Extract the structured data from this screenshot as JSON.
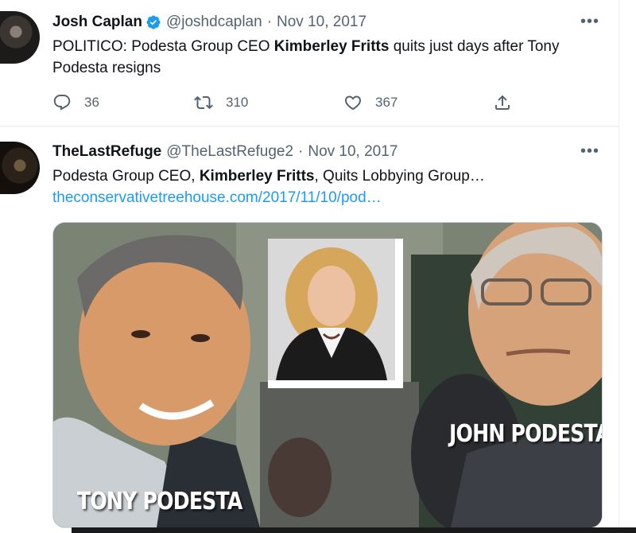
{
  "tweets": [
    {
      "author_name": "Josh Caplan",
      "author_handle": "@joshdcaplan",
      "separator": "·",
      "date": "Nov 10, 2017",
      "verified": true,
      "text_parts": {
        "before": "POLITICO: Podesta Group CEO ",
        "bold": "Kimberley Fritts",
        "after": " quits just days after Tony Podesta resigns"
      },
      "actions": {
        "reply_count": "36",
        "retweet_count": "310",
        "like_count": "367"
      },
      "more_icon": "more-horizontal-icon"
    },
    {
      "author_name": "TheLastRefuge",
      "author_handle": "@TheLastRefuge2",
      "separator": "·",
      "date": "Nov 10, 2017",
      "verified": false,
      "text_parts": {
        "before": "Podesta Group CEO, ",
        "bold": "Kimberley Fritts",
        "after": ", Quits Lobbying Group…"
      },
      "link": "theconservativetreehouse.com/2017/11/10/pod…",
      "media": {
        "caption_right": "JOHN PODESTA",
        "caption_left": "TONY PODESTA"
      },
      "more_icon": "more-horizontal-icon"
    }
  ],
  "colors": {
    "accent": "#1d9bf0",
    "secondary_text": "#536471",
    "primary_text": "#0f1419"
  }
}
